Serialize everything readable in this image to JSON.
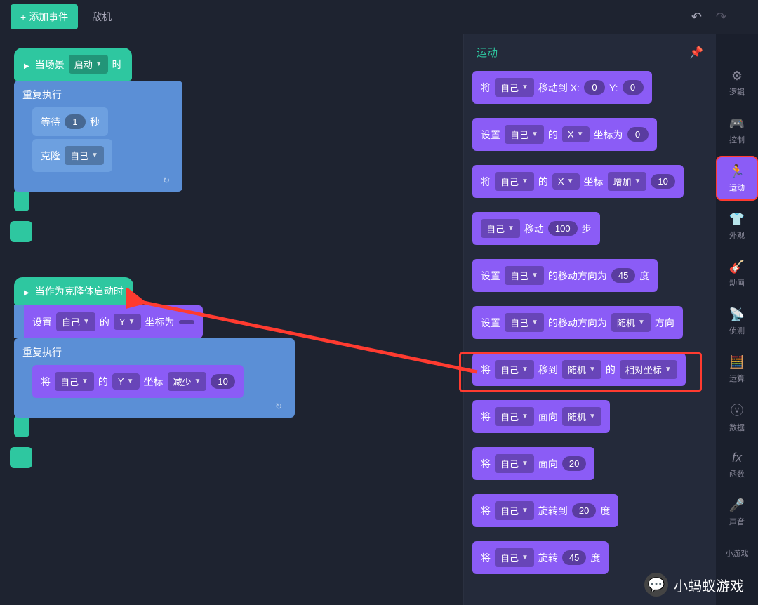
{
  "topbar": {
    "add_event": "添加事件",
    "tab": "敌机"
  },
  "canvas": {
    "hat1_prefix": "当场景",
    "hat1_slot": "启动",
    "hat1_suffix": "时",
    "repeat": "重复执行",
    "wait": "等待",
    "wait_val": "1",
    "wait_unit": "秒",
    "clone": "克隆",
    "self": "自己",
    "hat2": "当作为克隆体启动时",
    "set": "设置",
    "axis_y": "Y",
    "coord_is": "坐标为",
    "to": "将",
    "of": "的",
    "coord": "坐标",
    "decrease": "减少",
    "dec_val": "10"
  },
  "palette": {
    "title": "运动",
    "b1_to": "将",
    "b1_self": "自己",
    "b1_moveto": "移动到 X:",
    "b1_x": "0",
    "b1_y_lbl": "Y:",
    "b1_y": "0",
    "b2_set": "设置",
    "b2_self": "自己",
    "b2_of": "的",
    "b2_axis": "X",
    "b2_coord": "坐标为",
    "b2_val": "0",
    "b3_to": "将",
    "b3_self": "自己",
    "b3_of": "的",
    "b3_axis": "X",
    "b3_coord": "坐标",
    "b3_inc": "增加",
    "b3_val": "10",
    "b4_self": "自己",
    "b4_move": "移动",
    "b4_val": "100",
    "b4_step": "步",
    "b5_set": "设置",
    "b5_self": "自己",
    "b5_dir": "的移动方向为",
    "b5_val": "45",
    "b5_deg": "度",
    "b6_set": "设置",
    "b6_self": "自己",
    "b6_dir": "的移动方向为",
    "b6_rand": "随机",
    "b6_suf": "方向",
    "b7_to": "将",
    "b7_self": "自己",
    "b7_moveto": "移到",
    "b7_rand": "随机",
    "b7_of": "的",
    "b7_rel": "相对坐标",
    "b8_to": "将",
    "b8_self": "自己",
    "b8_face": "面向",
    "b8_rand": "随机",
    "b9_to": "将",
    "b9_self": "自己",
    "b9_face": "面向",
    "b9_val": "20",
    "b10_to": "将",
    "b10_self": "自己",
    "b10_rot": "旋转到",
    "b10_val": "20",
    "b10_deg": "度",
    "b11_to": "将",
    "b11_self": "自己",
    "b11_rot": "旋转",
    "b11_val": "45",
    "b11_deg": "度"
  },
  "sidebar": {
    "logic": "逻辑",
    "control": "控制",
    "motion": "运动",
    "look": "外观",
    "anim": "动画",
    "sense": "侦测",
    "op": "运算",
    "data": "数据",
    "func": "函数",
    "sound": "声音",
    "mini": "小游戏"
  },
  "watermark": {
    "text": "小蚂蚁游戏"
  }
}
